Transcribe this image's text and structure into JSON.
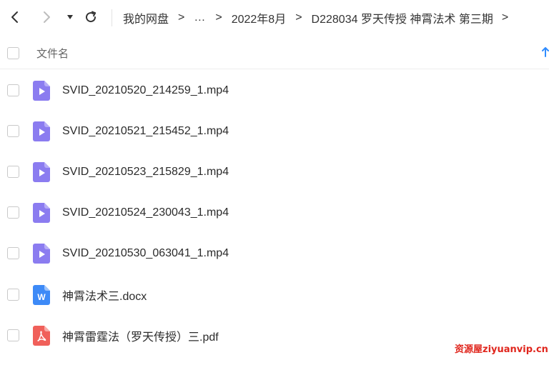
{
  "toolbar": {
    "back_icon": "chevron-left-icon",
    "forward_icon": "chevron-right-icon",
    "history_icon": "caret-down-icon",
    "refresh_icon": "refresh-icon"
  },
  "breadcrumb": {
    "items": [
      "我的网盘",
      "…",
      "2022年8月",
      "D228034 罗天传授 神霄法术 第三期"
    ],
    "separator": ">"
  },
  "list_header": {
    "column_name": "文件名",
    "sort_icon": "sort-arrow-up-icon"
  },
  "files": [
    {
      "name": "SVID_20210520_214259_1.mp4",
      "type": "video"
    },
    {
      "name": "SVID_20210521_215452_1.mp4",
      "type": "video"
    },
    {
      "name": "SVID_20210523_215829_1.mp4",
      "type": "video"
    },
    {
      "name": "SVID_20210524_230043_1.mp4",
      "type": "video"
    },
    {
      "name": "SVID_20210530_063041_1.mp4",
      "type": "video"
    },
    {
      "name": "神霄法术三.docx",
      "type": "word",
      "icon_letter": "W"
    },
    {
      "name": "神霄雷霆法（罗天传授）三.pdf",
      "type": "pdf"
    }
  ],
  "colors": {
    "video_icon": "#8b7cf0",
    "word_icon": "#3d8af7",
    "pdf_icon": "#f0605a",
    "accent": "#2f8cff",
    "watermark": "#e0261d"
  },
  "watermark": "资源屋ziyuanvip.cn"
}
